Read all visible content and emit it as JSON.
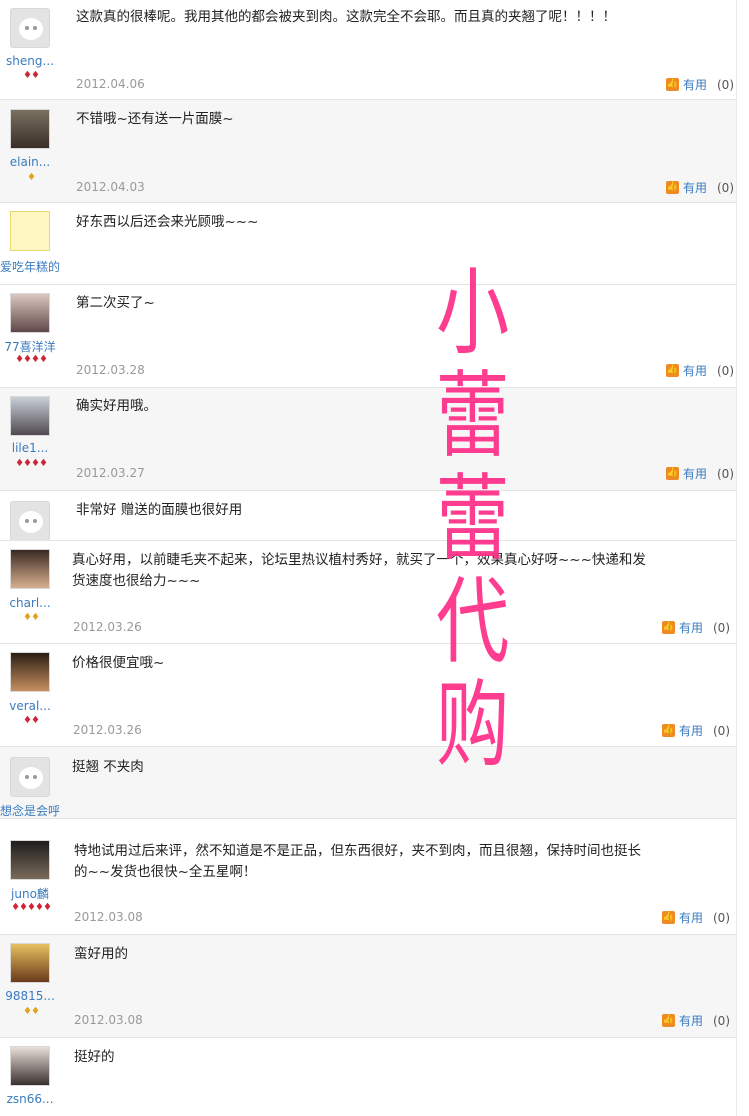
{
  "reviews": [
    {
      "user": "sheng...",
      "badges": "♦♦",
      "badge_color": "red",
      "comment": "这款真的很棒呢。我用其他的都会被夹到肉。这款完全不会耶。而且真的夹翘了呢！！！！",
      "date": "2012.04.06",
      "useful_label": "有用",
      "useful_count": "(0)"
    },
    {
      "user": "elain...",
      "badges": "♦",
      "badge_color": "gold",
      "comment": "不错哦~还有送一片面膜~",
      "date": "2012.04.03",
      "useful_label": "有用",
      "useful_count": "(0)"
    },
    {
      "user": "爱吃年糕的...",
      "badges": "",
      "badge_color": "",
      "comment": "好东西以后还会来光顾哦~~~",
      "date": "",
      "useful_label": "",
      "useful_count": ""
    },
    {
      "user": "77喜洋洋",
      "badges": "♦♦♦♦",
      "badge_color": "red",
      "comment": "第二次买了~",
      "date": "2012.03.28",
      "useful_label": "有用",
      "useful_count": "(0)"
    },
    {
      "user": "lile1...",
      "badges": "♦♦♦♦",
      "badge_color": "red",
      "comment": "确实好用哦。",
      "date": "2012.03.27",
      "useful_label": "有用",
      "useful_count": "(0)"
    },
    {
      "user": "",
      "badges": "",
      "badge_color": "",
      "comment": "非常好 赠送的面膜也很好用",
      "date": "",
      "useful_label": "",
      "useful_count": ""
    },
    {
      "user": "charl...",
      "badges": "♦♦",
      "badge_color": "gold",
      "comment": "真心好用，以前睫毛夹不起来，论坛里热议植村秀好，就买了一个，效果真心好呀~~~快递和发货速度也很给力~~~",
      "date": "2012.03.26",
      "useful_label": "有用",
      "useful_count": "(0)"
    },
    {
      "user": "veral...",
      "badges": "♦♦",
      "badge_color": "red",
      "comment": "价格很便宜哦~",
      "date": "2012.03.26",
      "useful_label": "有用",
      "useful_count": "(0)"
    },
    {
      "user": "想念是会呼...",
      "badges": "",
      "badge_color": "",
      "comment": "挺翘 不夹肉",
      "date": "",
      "useful_label": "",
      "useful_count": ""
    },
    {
      "user": "juno麟",
      "badges": "♦♦♦♦♦",
      "badge_color": "red",
      "comment": "特地试用过后来评，然不知道是不是正品，但东西很好，夹不到肉，而且很翘，保持时间也挺长的~~发货也很快~全五星啊！",
      "date": "2012.03.08",
      "useful_label": "有用",
      "useful_count": "(0)"
    },
    {
      "user": "98815...",
      "badges": "♦♦",
      "badge_color": "gold",
      "comment": "蛮好用的",
      "date": "2012.03.08",
      "useful_label": "有用",
      "useful_count": "(0)"
    },
    {
      "user": "zsn66...",
      "badges": "",
      "badge_color": "",
      "comment": "挺好的",
      "date": "",
      "useful_label": "",
      "useful_count": ""
    }
  ],
  "watermark": [
    "小",
    "蕾",
    "蕾",
    "代",
    "购"
  ],
  "colors": {
    "watermark": "#ff2d87",
    "username": "#3a7bbf",
    "useful_icon": "#f08a24"
  }
}
